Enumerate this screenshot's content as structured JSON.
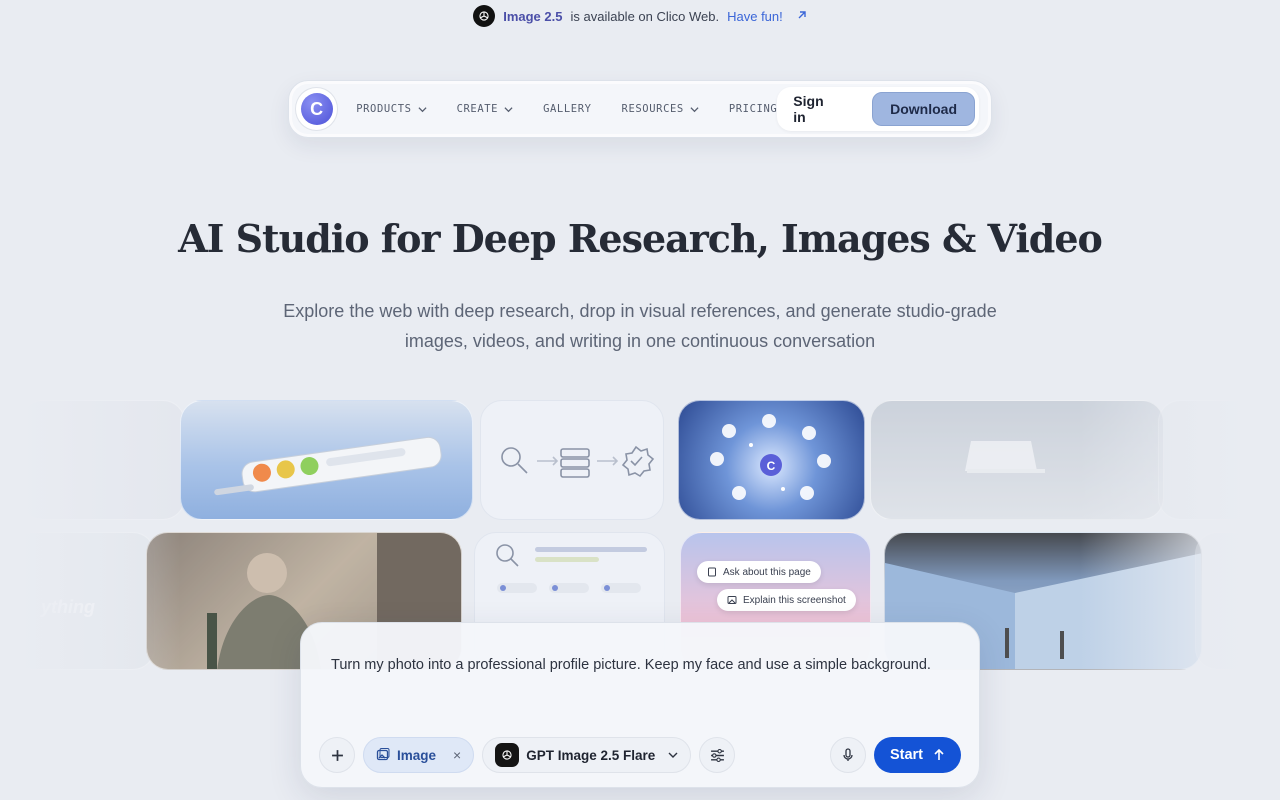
{
  "announcement": {
    "highlight": "Image 2.5",
    "text": "is available on Clico Web.",
    "link": "Have fun!",
    "icon": "arrow-up-right-icon"
  },
  "nav": {
    "brand_letter": "C",
    "links": [
      {
        "label": "PRODUCTS",
        "dropdown": true
      },
      {
        "label": "CREATE",
        "dropdown": true
      },
      {
        "label": "GALLERY",
        "dropdown": false
      },
      {
        "label": "RESOURCES",
        "dropdown": true
      },
      {
        "label": "PRICING",
        "dropdown": false
      }
    ],
    "signin": "Sign in",
    "download": "Download"
  },
  "hero": {
    "title": "AI Studio for Deep Research, Images & Video",
    "subtitle_line1": "Explore the web with deep research, drop in visual references, and generate studio-grade",
    "subtitle_line2": "images, videos, and writing in one continuous conversation"
  },
  "gallery": {
    "tag_ask": "Ask about this page",
    "tag_explain": "Explain this screenshot",
    "faded_text": "ything"
  },
  "prompt": {
    "text": "Turn my photo into a professional profile picture. Keep my face and use a simple background.",
    "image_chip": "Image",
    "model": "GPT Image 2.5 Flare",
    "start": "Start"
  },
  "colors": {
    "background": "#e9ecf2",
    "accent": "#1453d6",
    "download_bg": "#9fb6e0",
    "link": "#3b66d8"
  }
}
